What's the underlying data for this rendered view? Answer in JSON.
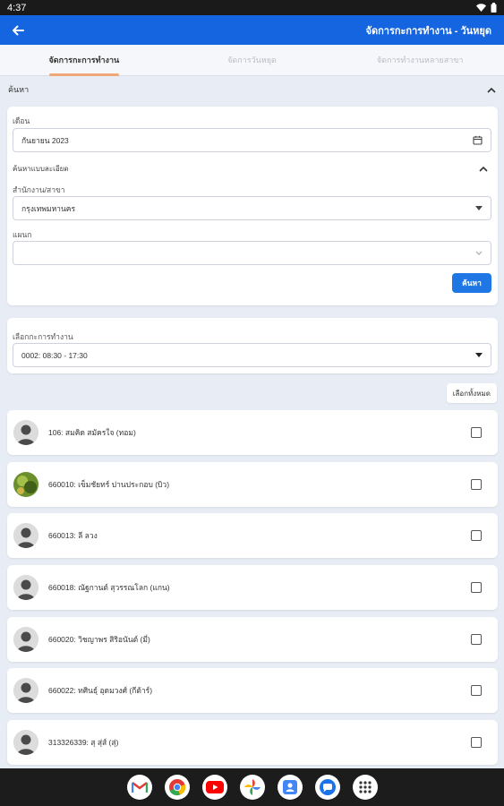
{
  "status_bar": {
    "time": "4:37"
  },
  "app_bar": {
    "title": "จัดการกะการทำงาน - วันหยุด"
  },
  "tabs": [
    {
      "label": "จัดการกะการทำงาน",
      "active": true
    },
    {
      "label": "จัดการวันหยุด",
      "active": false
    },
    {
      "label": "จัดการทำงานหลายสาขา",
      "active": false
    }
  ],
  "search_section": {
    "title": "ค้นหา",
    "month_label": "เดือน",
    "month_value": "กันยายน 2023",
    "advanced_label": "ค้นหาแบบละเอียด",
    "branch_label": "สำนักงาน/สาขา",
    "branch_value": "กรุงเทพมหานคร",
    "department_label": "แผนก",
    "department_value": "",
    "search_button": "ค้นหา"
  },
  "shift_section": {
    "label": "เลือกกะการทำงาน",
    "value": "0002: 08:30 - 17:30"
  },
  "select_all_label": "เลือกทั้งหมด",
  "employees": [
    {
      "name": "106: สมคิด สมัครใจ (ทอม)",
      "avatar": "placeholder"
    },
    {
      "name": "660010: เข็มชัยทร์ ปานประกอบ (บิว)",
      "avatar": "photo"
    },
    {
      "name": "660013: ลี ลวง",
      "avatar": "placeholder"
    },
    {
      "name": "660018: ณัฐกานต์ สุวรรณโลก (แกน)",
      "avatar": "placeholder"
    },
    {
      "name": "660020: วิชญาพร สิริอนันต์ (มี่)",
      "avatar": "placeholder"
    },
    {
      "name": "660022: ทศินธุ์ อุดมวงศ์ (กีต้าร์)",
      "avatar": "placeholder"
    },
    {
      "name": "313326339: สุ สุ่ส์ (สุ่)",
      "avatar": "placeholder"
    }
  ],
  "dock_apps": [
    "gmail-icon",
    "chrome-icon",
    "youtube-icon",
    "photos-icon",
    "contacts-icon",
    "messages-icon",
    "app-drawer-icon"
  ]
}
